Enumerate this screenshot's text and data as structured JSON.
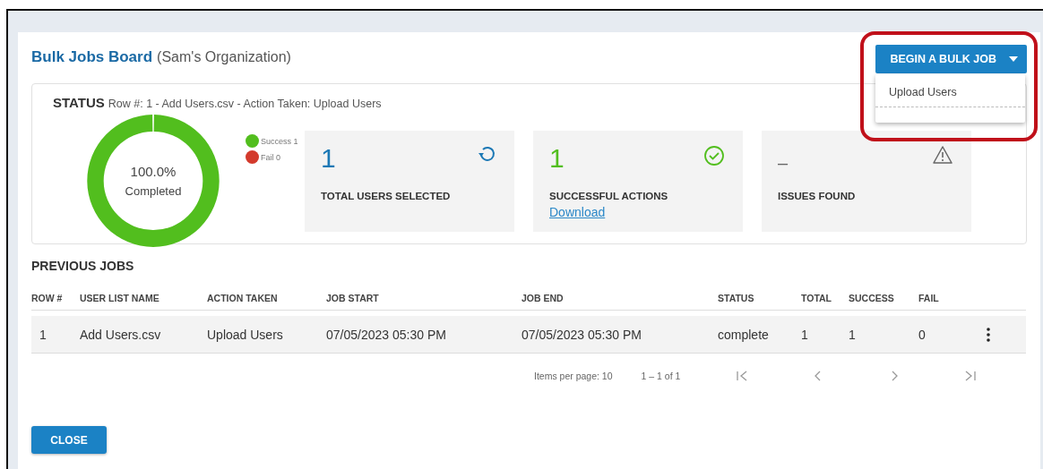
{
  "board": {
    "title": "Bulk Jobs Board",
    "organization": "(Sam's Organization)"
  },
  "begin_button": {
    "label": "BEGIN A BULK JOB",
    "expanded": true,
    "menu": [
      "Upload Users"
    ]
  },
  "status": {
    "heading": "STATUS",
    "detail": "Row #: 1 - Add Users.csv - Action Taken: Upload Users",
    "donut": {
      "percent": "100.0%",
      "caption": "Completed"
    },
    "legend": [
      {
        "label": "Success 1",
        "color": "#52be1e"
      },
      {
        "label": "Fail 0",
        "color": "#d33a2c"
      }
    ],
    "cards": [
      {
        "kind": "refresh",
        "value": "1",
        "label": "TOTAL USERS SELECTED"
      },
      {
        "kind": "check",
        "value": "1",
        "label": "SUCCESSFUL ACTIONS",
        "link": "Download"
      },
      {
        "kind": "warning",
        "value": "–",
        "label": "ISSUES FOUND"
      }
    ]
  },
  "previous_jobs": {
    "heading": "PREVIOUS JOBS",
    "columns": [
      "ROW #",
      "USER LIST NAME",
      "ACTION TAKEN",
      "JOB START",
      "JOB END",
      "STATUS",
      "TOTAL",
      "SUCCESS",
      "FAIL"
    ],
    "rows": [
      [
        "1",
        "Add Users.csv",
        "Upload Users",
        "07/05/2023 05:30 PM",
        "07/05/2023 05:30 PM",
        "complete",
        "1",
        "1",
        "0"
      ]
    ],
    "pagination": {
      "items_per_page": "Items per page: 10",
      "range": "1 – 1 of 1"
    }
  },
  "close_button": "CLOSE"
}
